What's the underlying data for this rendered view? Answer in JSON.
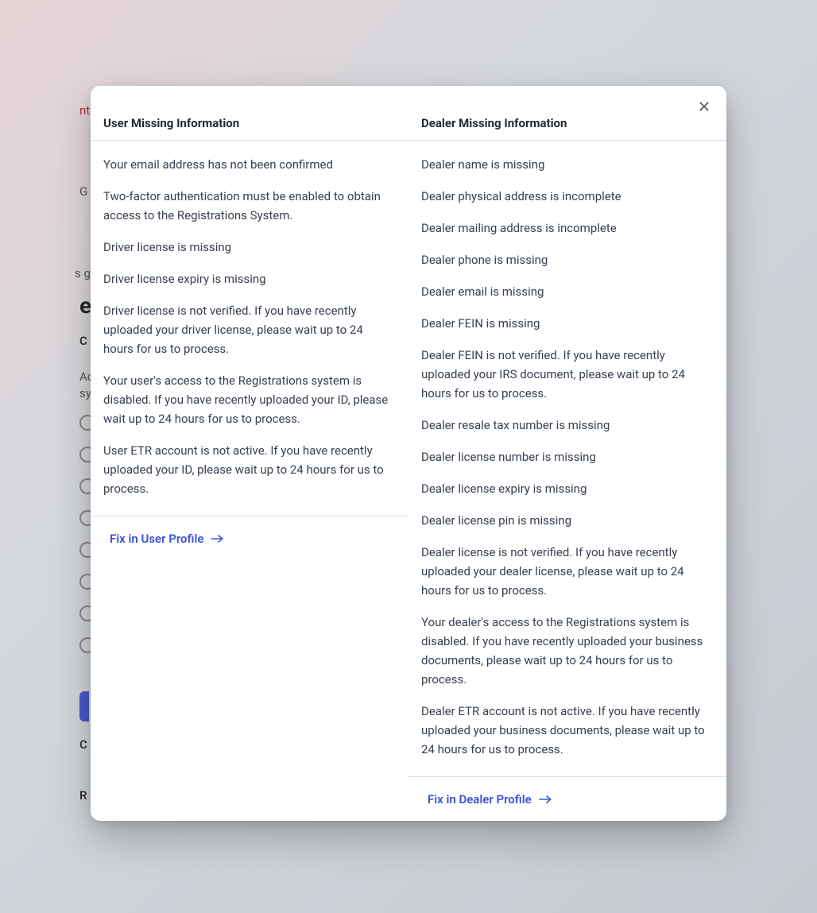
{
  "background": {
    "top_link_fragment": "nt",
    "header_fragment": "G",
    "large_fragment": "e",
    "subtext_fragment": "s g",
    "label_c1": "C",
    "label_ac": "Ac",
    "label_sy": "sy",
    "label_c2": "C",
    "label_r": "R"
  },
  "modal": {
    "user": {
      "header": "User Missing Information",
      "items": [
        "Your email address has not been confirmed",
        "Two-factor authentication must be enabled to obtain access to the Registrations System.",
        "Driver license is missing",
        "Driver license expiry is missing",
        "Driver license is not verified. If you have recently uploaded your driver license, please wait up to 24 hours for us to process.",
        "Your user's access to the Registrations system is disabled. If you have recently uploaded your ID, please wait up to 24 hours for us to process.",
        "User ETR account is not active. If you have recently uploaded your ID, please wait up to 24 hours for us to process."
      ],
      "fix_label": "Fix in User Profile"
    },
    "dealer": {
      "header": "Dealer Missing Information",
      "items": [
        "Dealer name is missing",
        "Dealer physical address is incomplete",
        "Dealer mailing address is incomplete",
        "Dealer phone is missing",
        "Dealer email is missing",
        "Dealer FEIN is missing",
        "Dealer FEIN is not verified. If you have recently uploaded your IRS document, please wait up to 24 hours for us to process.",
        "Dealer resale tax number is missing",
        "Dealer license number is missing",
        "Dealer license expiry is missing",
        "Dealer license pin is missing",
        "Dealer license is not verified. If you have recently uploaded your dealer license, please wait up to 24 hours for us to process.",
        "Your dealer's access to the Registrations system is disabled. If you have recently uploaded your business documents, please wait up to 24 hours for us to process.",
        "Dealer ETR account is not active. If you have recently uploaded your business documents, please wait up to 24 hours for us to process."
      ],
      "fix_label": "Fix in Dealer Profile"
    }
  }
}
